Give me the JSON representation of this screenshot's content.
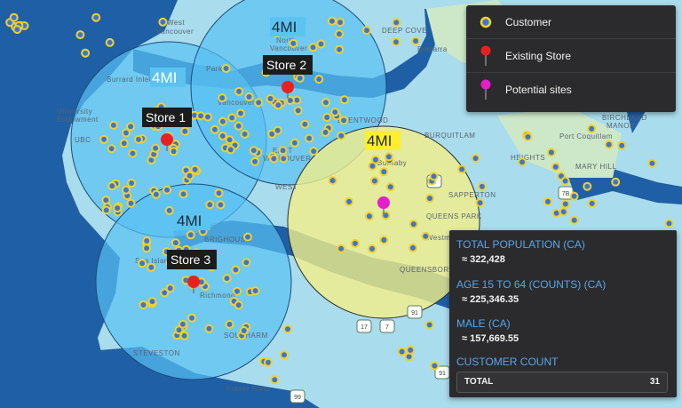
{
  "legend": {
    "customer": "Customer",
    "existing_store": "Existing Store",
    "potential_sites": "Potential sites"
  },
  "stores": [
    {
      "label": "Store 1"
    },
    {
      "label": "Store 2"
    },
    {
      "label": "Store 3"
    }
  ],
  "radius_labels": [
    "4MI",
    "4MI",
    "4MI",
    "4MI"
  ],
  "places": [
    "West",
    "Vancouver",
    "North",
    "Vancouver",
    "DEEP COVE",
    "Belcarra",
    "University",
    "Endowment",
    "UBC",
    "Vancouver",
    "BRENTWOOD",
    "EAST",
    "VANCOUVER",
    "Burnaby",
    "BURQUITLAM",
    "Port Coquitlam",
    "MARY HILL",
    "BIRCHLAND",
    "MANOR",
    "SAPPERTON",
    "QUEENS PARK",
    "Westm",
    "QUEENSBOROUGH",
    "BRIGHOUSE",
    "Richmond",
    "SOUTHARM",
    "STEVESTON",
    "Sea Island",
    "Fraser River",
    "Burrard Inlet",
    "HEIGHTS",
    "WEST",
    "Park"
  ],
  "highways": [
    "1",
    "7",
    "91",
    "99",
    "17",
    "7B",
    "91"
  ],
  "stats": {
    "total_population_title": "TOTAL POPULATION (CA)",
    "total_population_value": "≈ 322,428",
    "age_title": "AGE 15 TO 64 (COUNTS) (CA)",
    "age_value": "≈ 225,346.35",
    "male_title": "MALE (CA)",
    "male_value": "≈ 157,669.55",
    "customer_count_title": "CUSTOMER COUNT",
    "total_label": "TOTAL",
    "total_value": "31"
  },
  "colors": {
    "water": "#1f5fa5",
    "land": "#9fd8ea",
    "blue_radius": "#57c1f2",
    "yellow_radius": "#f3ef8a",
    "store_red": "#e8211f",
    "potential_magenta": "#e51ec8",
    "customer_fill": "#3f74d6",
    "customer_ring": "#f1d226",
    "stat_title": "#5aa6e6",
    "panel": "#2b2b2d"
  }
}
